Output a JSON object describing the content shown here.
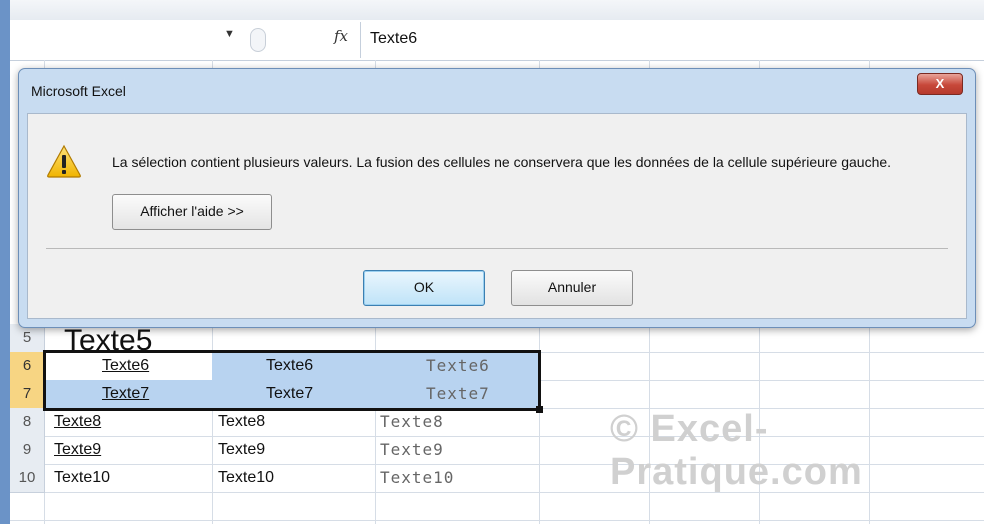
{
  "formula_bar": {
    "fx_label": "fx",
    "value": "Texte6"
  },
  "dialog": {
    "title": "Microsoft Excel",
    "close_label": "X",
    "message": "La sélection contient plusieurs valeurs. La fusion des cellules ne conservera que les données de la cellule supérieure gauche.",
    "help_button": "Afficher l'aide >>",
    "ok_button": "OK",
    "cancel_button": "Annuler",
    "icon": "warning-icon"
  },
  "sheet": {
    "row5": {
      "number": "5",
      "a": "Texte5"
    },
    "row6": {
      "number": "6",
      "a": "Texte6",
      "b": "Texte6",
      "c": "Texte6"
    },
    "row7": {
      "number": "7",
      "a": "Texte7",
      "b": "Texte7",
      "c": "Texte7"
    },
    "row8": {
      "number": "8",
      "a": "Texte8",
      "b": "Texte8",
      "c": "Texte8"
    },
    "row9": {
      "number": "9",
      "a": "Texte9",
      "b": "Texte9",
      "c": "Texte9"
    },
    "row10": {
      "number": "10",
      "a": "Texte10",
      "b": "Texte10",
      "c": "Texte10"
    }
  },
  "watermark": "© Excel-Pratique.com",
  "colors": {
    "selection": "#b8d3f0",
    "row_header_selected": "#f7d583",
    "dialog_frame": "#c8dcf1",
    "close_button": "#c7483a"
  }
}
